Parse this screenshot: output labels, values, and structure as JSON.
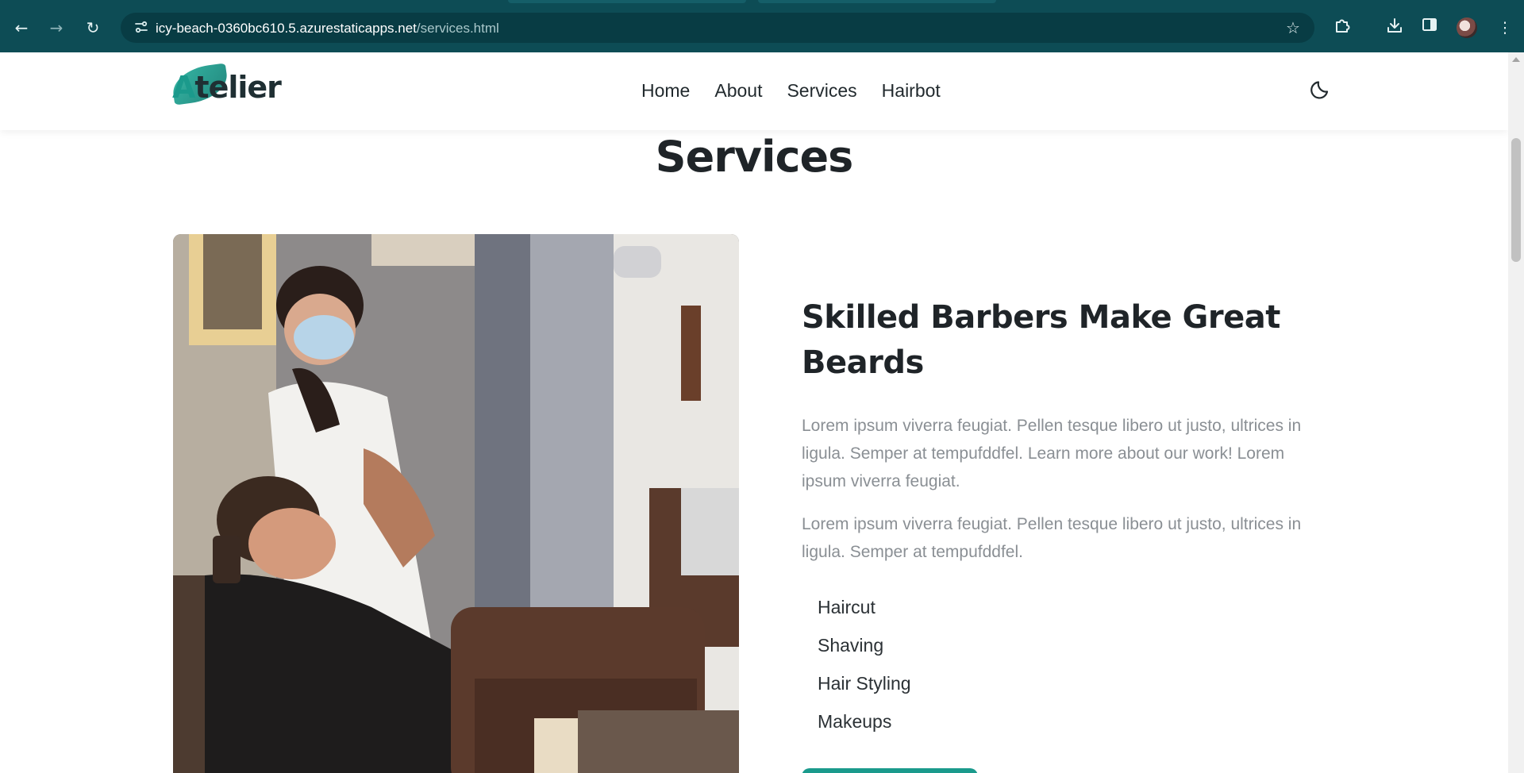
{
  "browser": {
    "url_host": "icy-beach-0360bc610.5.azurestaticapps.net",
    "url_path": "/services.html",
    "icons": {
      "back": "back-arrow-icon",
      "forward": "forward-arrow-icon",
      "reload": "reload-icon",
      "site_info": "site-info-icon",
      "bookmark": "star-icon",
      "extensions": "puzzle-icon",
      "downloads": "download-icon",
      "side_panel": "side-panel-icon",
      "profile": "profile-avatar",
      "menu": "kebab-menu-icon"
    }
  },
  "site": {
    "logo": {
      "accent_letter": "A",
      "rest": "telier"
    },
    "nav": [
      "Home",
      "About",
      "Services",
      "Hairbot"
    ],
    "theme_toggle_icon": "moon-icon"
  },
  "main": {
    "title": "Services",
    "feature": {
      "heading": "Skilled Barbers Make Great Beards",
      "paragraph_1": "Lorem ipsum viverra feugiat. Pellen tesque libero ut justo, ultrices in ligula. Semper at tempufddfel. Learn more about our work! Lorem ipsum viverra feugiat.",
      "paragraph_2": "Lorem ipsum viverra feugiat. Pellen tesque libero ut justo, ultrices in ligula. Semper at tempufddfel.",
      "services": [
        "Haircut",
        "Shaving",
        "Hair Styling",
        "Makeups"
      ]
    }
  },
  "colors": {
    "chrome": "#0d4c55",
    "accent": "#1a9a8c",
    "heading": "#1f2428",
    "body_text": "#8a8f94"
  }
}
